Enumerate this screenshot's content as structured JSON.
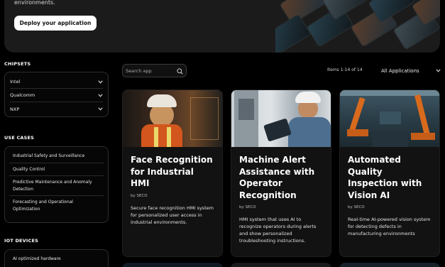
{
  "hero": {
    "text": "environments.",
    "deploy_label": "Deploy your application"
  },
  "sidebar": {
    "chipsets": {
      "heading": "CHIPSETS",
      "items": [
        {
          "label": "Intel"
        },
        {
          "label": "Qualcomm"
        },
        {
          "label": "NXP"
        }
      ]
    },
    "use_cases": {
      "heading": "USE CASES",
      "items": [
        {
          "label": "Industrial Safety and Surveillance"
        },
        {
          "label": "Quality Control"
        },
        {
          "label": "Predictive Maintenance and Anomaly Detection"
        },
        {
          "label": "Forecasting and Operational Optimization"
        }
      ]
    },
    "iot_devices": {
      "heading": "IOT DEVICES",
      "items": [
        {
          "label": "AI optimized hardware"
        }
      ]
    }
  },
  "toolbar": {
    "search_placeholder": "Search app",
    "items_count": "Items 1-14 of 14",
    "filter_value": "All Applications"
  },
  "cards": [
    {
      "title": "Face Recognition for Industrial HMI",
      "author": "by SECO",
      "description": "Secure face recognition HMI system for personalized user access in industrial environments."
    },
    {
      "title": "Machine Alert Assistance with Operator Recognition",
      "author": "by SECO",
      "description": "HMI system that uses AI to recognize operators during alerts and show personalized troubleshooting instructions."
    },
    {
      "title": "Automated Quality Inspection with Vision AI",
      "author": "by SECO",
      "description": "Real-time AI-powered vision system for detecting defects in manufacturing environments"
    }
  ]
}
